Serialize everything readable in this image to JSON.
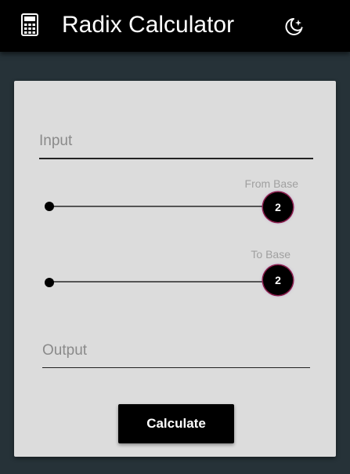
{
  "app": {
    "title": "Radix Calculator",
    "icon": "calculator-icon",
    "theme_icon": "moon-stars-icon"
  },
  "form": {
    "input_placeholder": "Input",
    "input_value": "",
    "output_placeholder": "Output",
    "output_value": "",
    "from_base": {
      "label": "From Base",
      "value": "2"
    },
    "to_base": {
      "label": "To Base",
      "value": "2"
    },
    "calculate_label": "Calculate"
  },
  "colors": {
    "appbar": "#000000",
    "background": "#263238",
    "card": "#dcdcdc",
    "accent": "#000000",
    "thumb_ring": "#8a1c4a"
  }
}
